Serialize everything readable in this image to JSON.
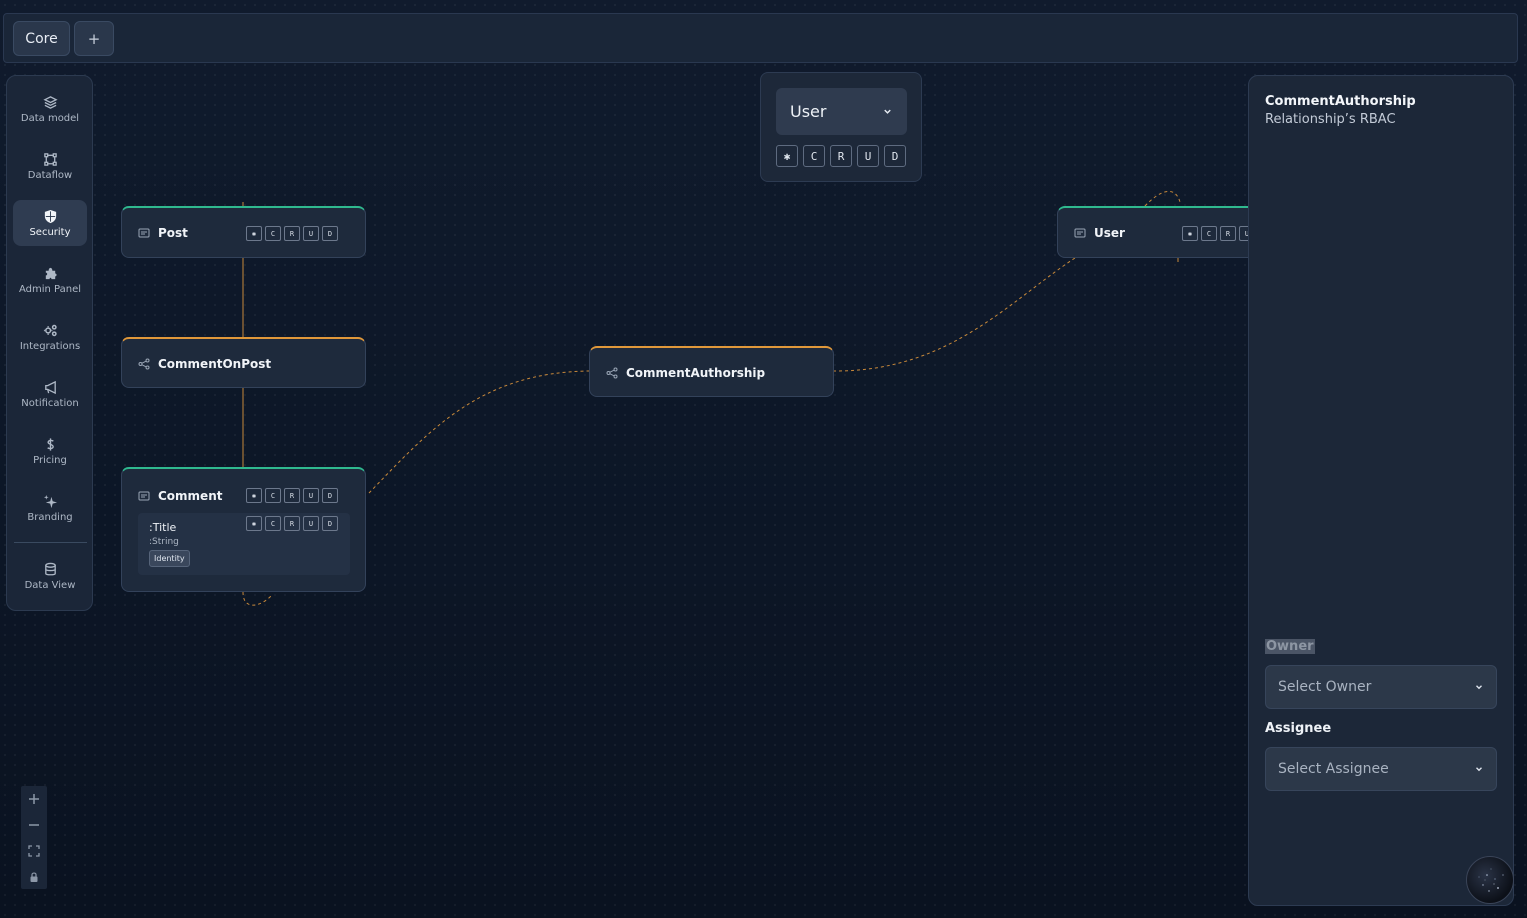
{
  "tabs": {
    "core_label": "Core",
    "add_label": "+"
  },
  "sidebar": {
    "items": [
      {
        "label": "Data model",
        "icon": "layers-icon"
      },
      {
        "label": "Dataflow",
        "icon": "flow-icon"
      },
      {
        "label": "Security",
        "icon": "shield-icon",
        "active": true
      },
      {
        "label": "Admin Panel",
        "icon": "puzzle-icon"
      },
      {
        "label": "Integrations",
        "icon": "gears-icon"
      },
      {
        "label": "Notification",
        "icon": "megaphone-icon"
      },
      {
        "label": "Pricing",
        "icon": "dollar-icon"
      },
      {
        "label": "Branding",
        "icon": "sparkle-icon"
      },
      {
        "label": "Data View",
        "icon": "database-icon"
      }
    ]
  },
  "role_selector": {
    "value": "User",
    "perms": [
      "✱",
      "C",
      "R",
      "U",
      "D"
    ]
  },
  "perms_small": [
    "✱",
    "C",
    "R",
    "U",
    "D"
  ],
  "nodes": {
    "post": {
      "label": "Post"
    },
    "comment_on_post": {
      "label": "CommentOnPost"
    },
    "comment": {
      "label": "Comment",
      "field": {
        "name": ":Title",
        "type": ":String",
        "tag": "Identity"
      }
    },
    "comment_authorship": {
      "label": "CommentAuthorship"
    },
    "user": {
      "label": "User"
    }
  },
  "right_panel": {
    "title": "CommentAuthorship",
    "subtitle": "Relationship’s RBAC",
    "owner_label": "Owner",
    "owner_placeholder": "Select Owner",
    "assignee_label": "Assignee",
    "assignee_placeholder": "Select Assignee"
  },
  "colors": {
    "entity_accent": "#2fb98f",
    "relation_accent": "#e0983a",
    "edge": "#c8893a"
  }
}
